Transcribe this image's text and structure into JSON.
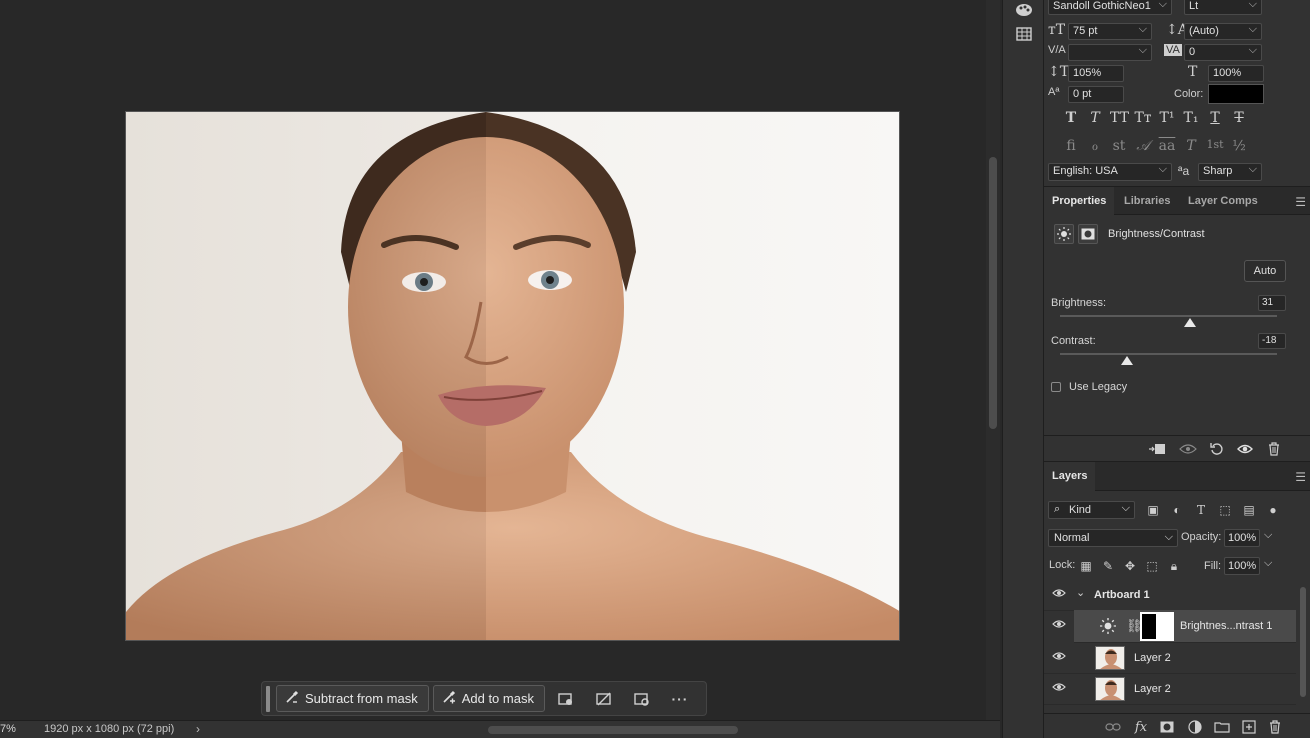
{
  "status_bar": {
    "zoom": "7%",
    "doc_info": "1920 px x 1080 px (72 ppi)",
    "arrow": "›"
  },
  "task_bar": {
    "subtract_label": "Subtract from mask",
    "add_label": "Add to mask",
    "more_label": "···"
  },
  "character": {
    "font_family": "Sandoll GothicNeo1",
    "font_style": "Lt",
    "size": "75 pt",
    "leading": "(Auto)",
    "kerning": "",
    "tracking": "0",
    "vertical_scale": "105%",
    "horizontal_scale": "100%",
    "baseline_shift": "0 pt",
    "color_label": "Color:",
    "color_value": "#000000",
    "language": "English: USA",
    "antialias": "Sharp",
    "aa_label": "ªa",
    "style_buttons": [
      "T",
      "T",
      "TT",
      "Tт",
      "T¹",
      "T₁",
      "T",
      "T"
    ],
    "opentype_buttons": [
      "ﬁ",
      "ℴ",
      "st",
      "𝒜",
      "aa",
      "T",
      "1st",
      "½"
    ]
  },
  "properties": {
    "tabs": [
      "Properties",
      "Libraries",
      "Layer Comps"
    ],
    "active_tab": "Properties",
    "adjustment_title": "Brightness/Contrast",
    "auto_label": "Auto",
    "brightness_label": "Brightness:",
    "brightness_value": "31",
    "brightness_fraction": 0.6,
    "contrast_label": "Contrast:",
    "contrast_value": "-18",
    "contrast_fraction": 0.31,
    "use_legacy_label": "Use Legacy"
  },
  "layers": {
    "tab": "Layers",
    "kind_label": "Kind",
    "blend_mode": "Normal",
    "opacity_label": "Opacity:",
    "opacity_value": "100%",
    "lock_label": "Lock:",
    "fill_label": "Fill:",
    "fill_value": "100%",
    "items": [
      {
        "name": "Artboard 1",
        "type": "artboard"
      },
      {
        "name": "Brightnes...ntrast 1",
        "type": "adjustment",
        "selected": true
      },
      {
        "name": "Layer 2",
        "type": "pixel"
      },
      {
        "name": "Layer 2",
        "type": "pixel"
      }
    ]
  },
  "colors": {
    "canvas_bg": "#282828",
    "panel_bg": "#323232",
    "accent_knob": "#e8e8e8"
  }
}
